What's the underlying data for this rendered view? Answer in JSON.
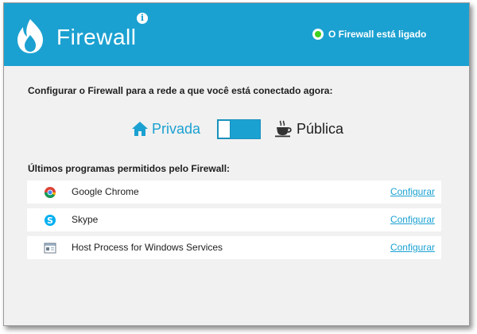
{
  "header": {
    "title": "Firewall",
    "status_text": "O Firewall está ligado",
    "accent_color": "#1ba1d1",
    "status_color": "#3fd01f"
  },
  "network": {
    "question": "Configurar o Firewall para a rede a que você está conectado agora:",
    "private_label": "Privada",
    "public_label": "Pública",
    "selected": "Privada"
  },
  "programs": {
    "heading": "Últimos programas permitidos pelo Firewall:",
    "items": [
      {
        "name": "Google Chrome",
        "icon": "chrome-icon",
        "action": "Configurar"
      },
      {
        "name": "Skype",
        "icon": "skype-icon",
        "action": "Configurar"
      },
      {
        "name": "Host Process for Windows Services",
        "icon": "windows-service-icon",
        "action": "Configurar"
      }
    ]
  }
}
